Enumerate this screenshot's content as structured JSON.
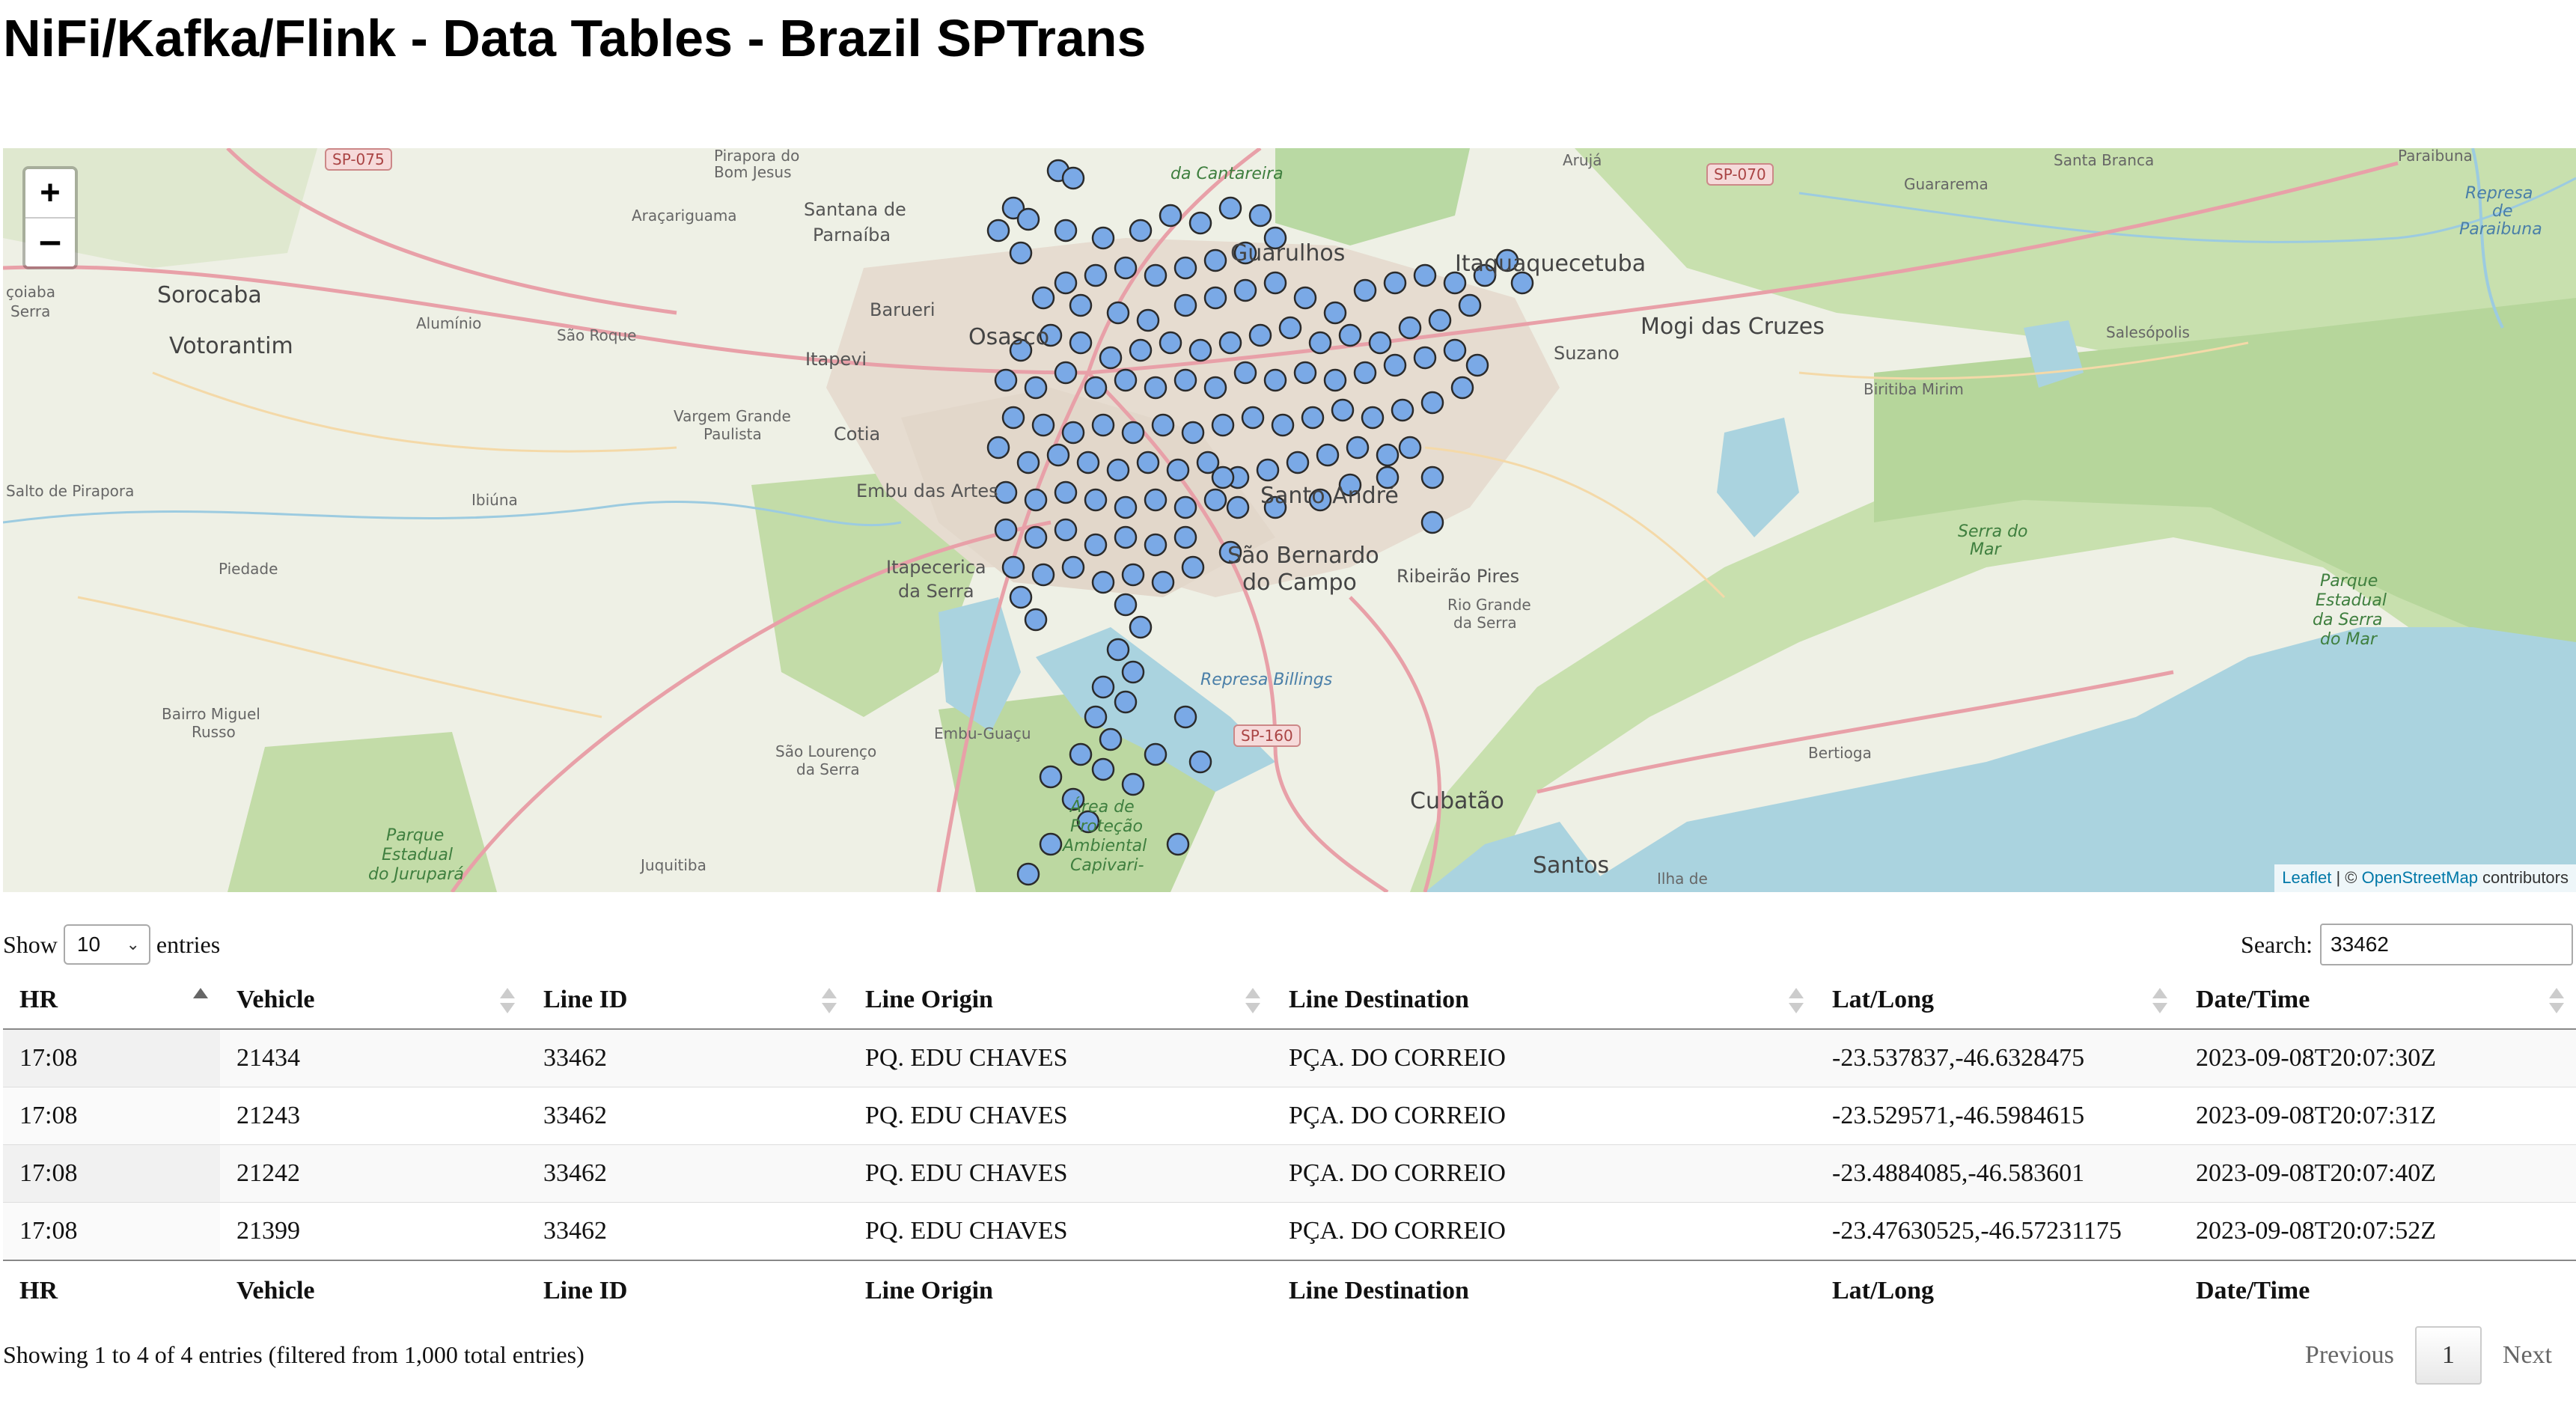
{
  "page": {
    "title": "NiFi/Kafka/Flink - Data Tables - Brazil SPTrans"
  },
  "map": {
    "zoom_in": "+",
    "zoom_out": "–",
    "attribution": {
      "leaflet": "Leaflet",
      "sep": " | © ",
      "osm": "OpenStreetMap",
      "suffix": " contributors"
    },
    "marker_color": "#7aa9e6",
    "labels": {
      "sorocaba": "Sorocaba",
      "votorantim": "Votorantim",
      "santana": "Santana de",
      "parnaiba": "Parnaíba",
      "barueri": "Barueri",
      "osasco": "Osasco",
      "itapevi": "Itapevi",
      "cotia": "Cotia",
      "guarulhos": "Guarulhos",
      "itaquaquecetuba": "Itaquaquecetuba",
      "suzano": "Suzano",
      "mogi": "Mogi das Cruzes",
      "santo_andre": "Santo André",
      "sbc1": "São Bernardo",
      "sbc2": "do Campo",
      "ribeirao": "Ribeirão Pires",
      "embu": "Embu das Artes",
      "itapecerica1": "Itapecerica",
      "itapecerica2": "da Serra",
      "cubatao": "Cubatão",
      "santos": "Santos",
      "bertioga": "Bertioga",
      "guararema": "Guararema",
      "santa_branca": "Santa Branca",
      "salesopolis": "Salesópolis",
      "biritiba": "Biritiba Mirim",
      "aruja": "Arujá",
      "pirapora1": "Pirapora do",
      "pirapora2": "Bom Jesus",
      "aracariguama": "Araçariguama",
      "aluminio": "Alumínio",
      "sao_roque": "São Roque",
      "vargem1": "Vargem Grande",
      "vargem2": "Paulista",
      "ibiuna": "Ibiúna",
      "salto": "Salto de Pirapora",
      "piedade": "Piedade",
      "bairro1": "Bairro Miguel",
      "bairro2": "Russo",
      "embu_guacu": "Embu-Guaçu",
      "slourenco1": "São Lourenço",
      "slourenco2": "da Serra",
      "juquitiba": "Juquitiba",
      "rio_grande1": "Rio Grande",
      "rio_grande2": "da Serra",
      "serra_do_mar": "Serra do",
      "serra_do_mar2": "Mar",
      "ilha": "Ilha de",
      "paraibuna": "Paraibuna",
      "park1": "Parque",
      "park2": "Estadual",
      "park3": "do Jurupará",
      "park_cantareira": "da Cantareira",
      "protecao1": "Área de",
      "protecao2": "Proteção",
      "protecao3": "Ambiental",
      "protecao4": "Capivari-",
      "parque_mar1": "Parque",
      "parque_mar2": "Estadual",
      "parque_mar3": "da Serra",
      "parque_mar4": "do Mar",
      "represa1": "Represa",
      "represa2": "de",
      "represa3": "Paraibuna",
      "billings": "Represa Billings",
      "coiaba": "çoiaba",
      "serra": "Serra"
    },
    "shields": {
      "sp075": "SP-075",
      "sp070": "SP-070",
      "sp160": "SP-160"
    }
  },
  "controls": {
    "show_label": "Show",
    "page_length": "10",
    "entries_label": "entries",
    "search_label": "Search:",
    "search_value": "33462"
  },
  "table": {
    "columns": [
      "HR",
      "Vehicle",
      "Line ID",
      "Line Origin",
      "Line Destination",
      "Lat/Long",
      "Date/Time"
    ],
    "rows": [
      [
        "17:08",
        "21434",
        "33462",
        "PQ. EDU CHAVES",
        "PÇA. DO CORREIO",
        "-23.537837,-46.6328475",
        "2023-09-08T20:07:30Z"
      ],
      [
        "17:08",
        "21243",
        "33462",
        "PQ. EDU CHAVES",
        "PÇA. DO CORREIO",
        "-23.529571,-46.5984615",
        "2023-09-08T20:07:31Z"
      ],
      [
        "17:08",
        "21242",
        "33462",
        "PQ. EDU CHAVES",
        "PÇA. DO CORREIO",
        "-23.4884085,-46.583601",
        "2023-09-08T20:07:40Z"
      ],
      [
        "17:08",
        "21399",
        "33462",
        "PQ. EDU CHAVES",
        "PÇA. DO CORREIO",
        "-23.47630525,-46.57231175",
        "2023-09-08T20:07:52Z"
      ]
    ],
    "sorted_column": "HR",
    "sort_direction": "ascending"
  },
  "footer": {
    "info": "Showing 1 to 4 of 4 entries (filtered from 1,000 total entries)",
    "previous": "Previous",
    "current_page": "1",
    "next": "Next"
  }
}
